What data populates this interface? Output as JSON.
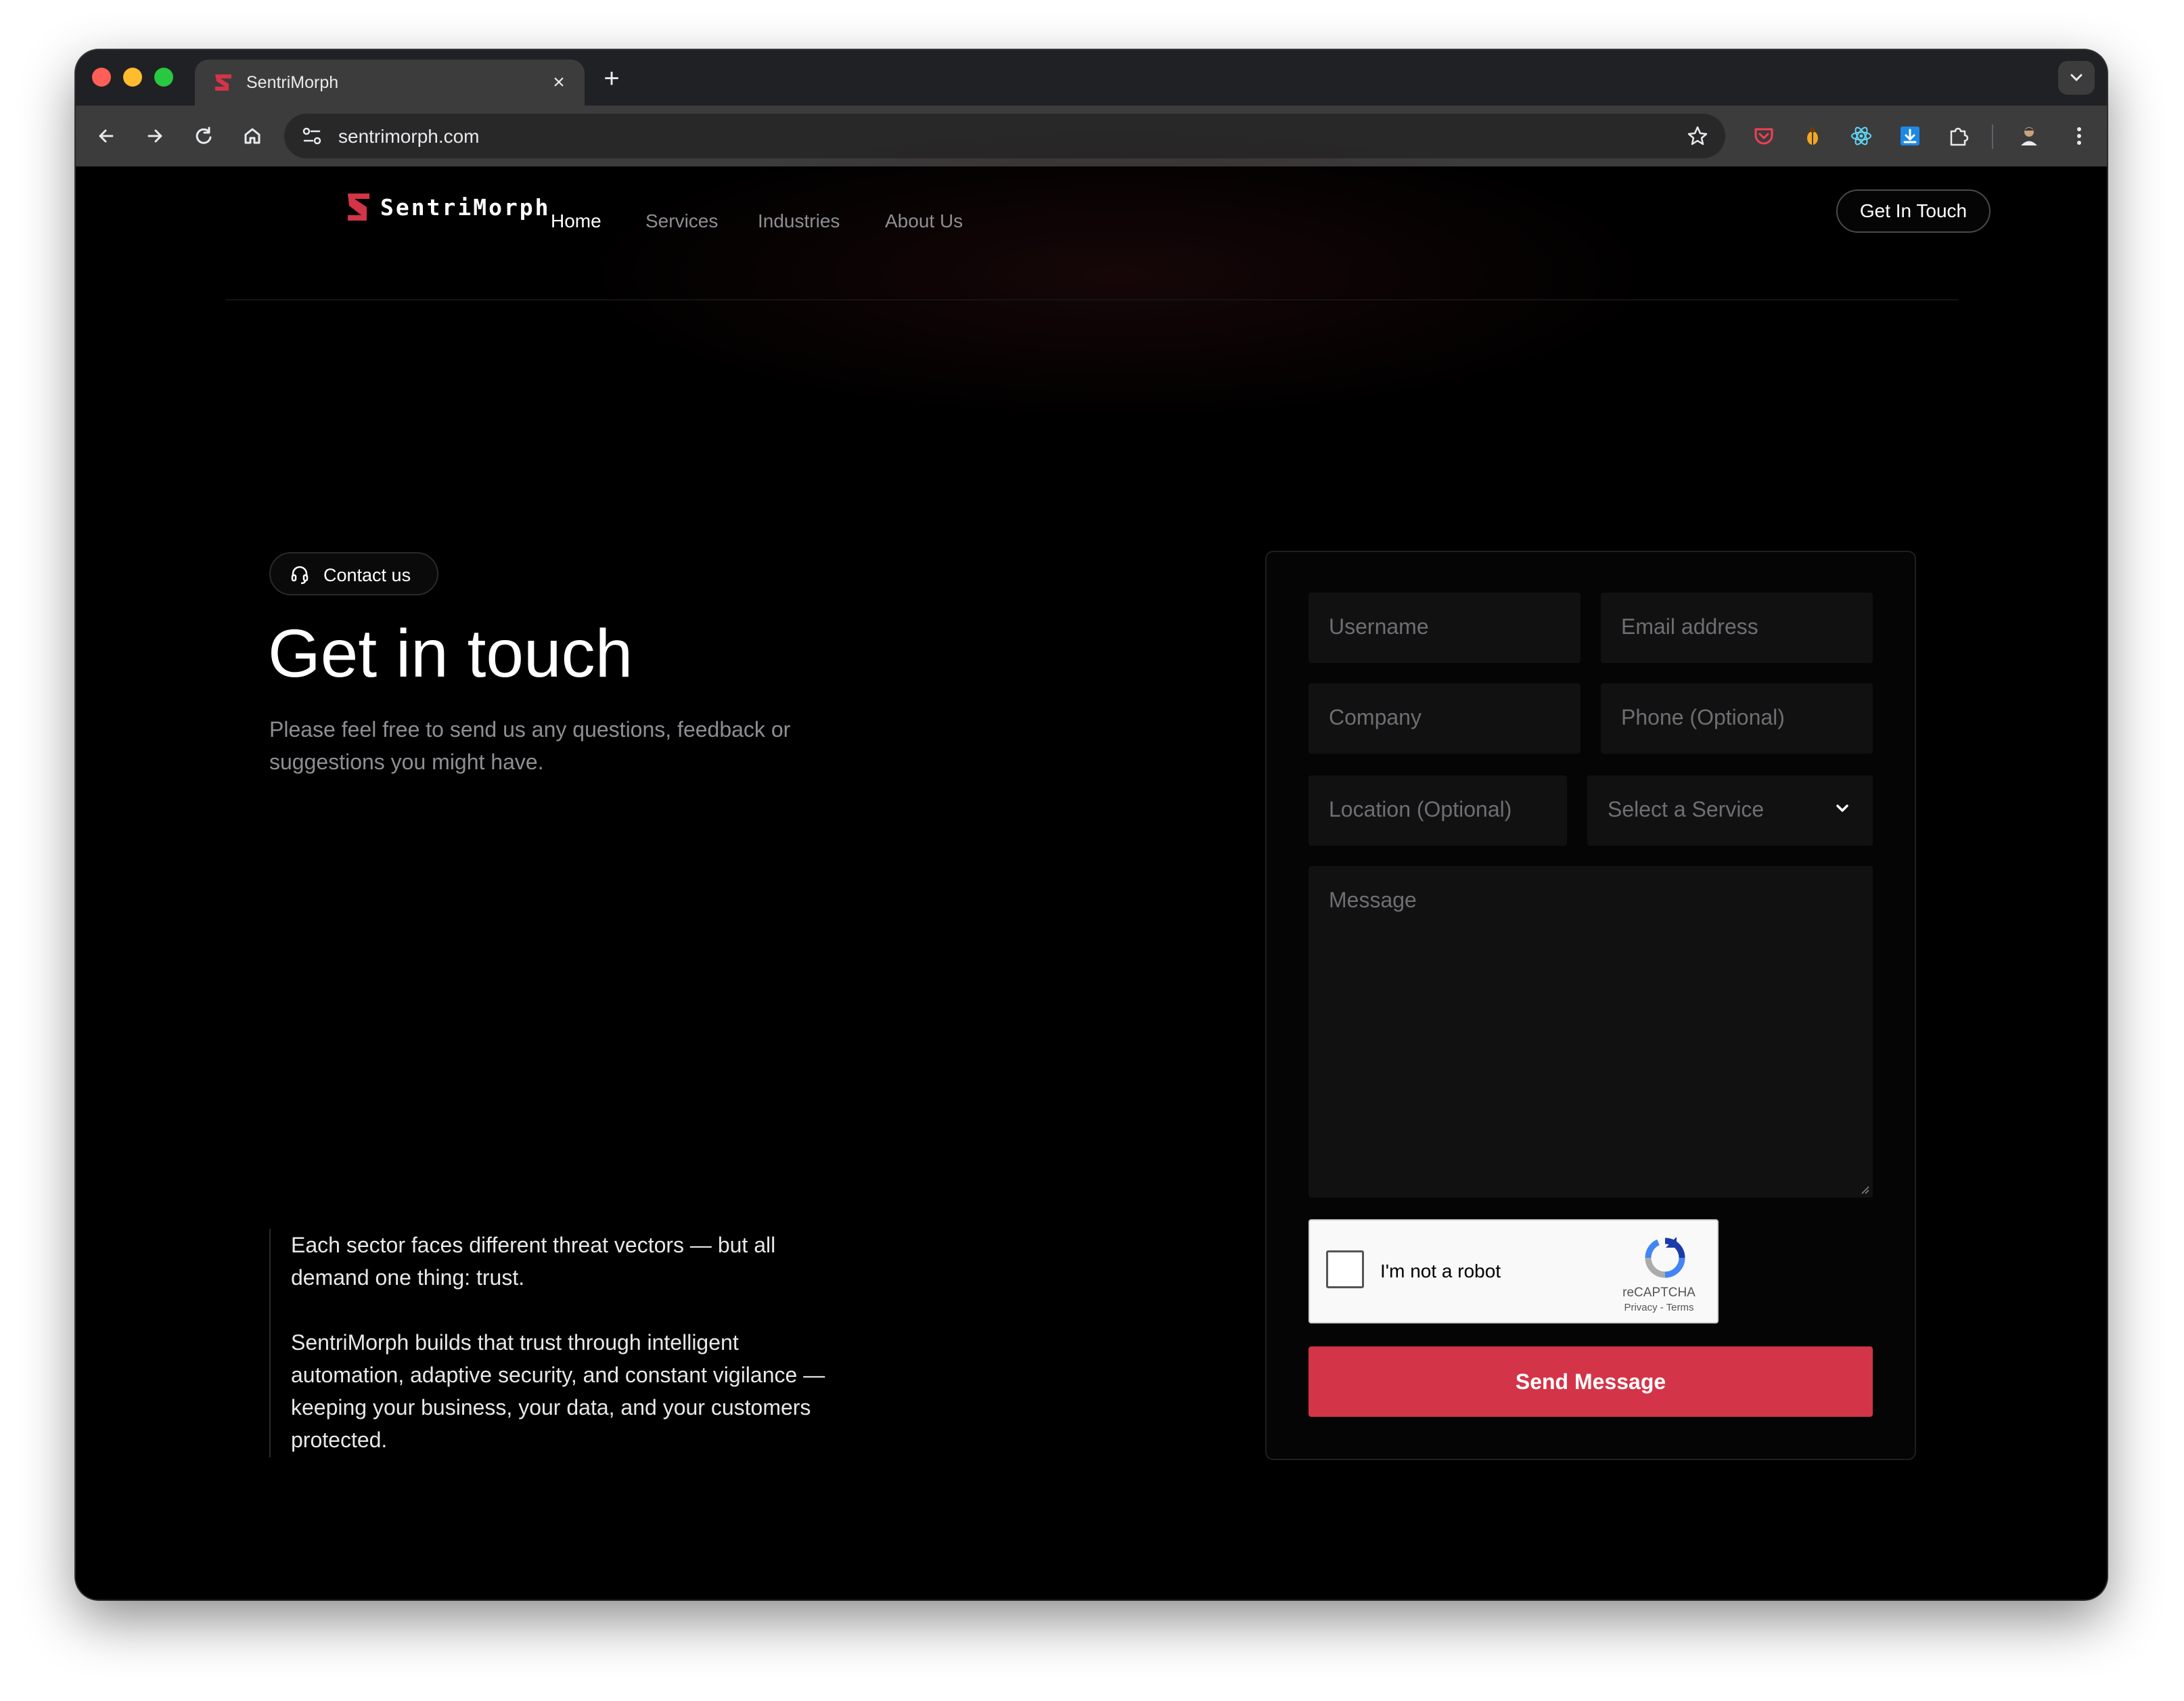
{
  "browser": {
    "tab_title": "SentriMorph",
    "url": "sentrimorph.com",
    "extensions": [
      "pocket-icon",
      "bug-icon",
      "react-icon",
      "download-icon",
      "puzzle-icon",
      "profile-icon"
    ]
  },
  "site": {
    "logo_text": "SentriMorph",
    "nav": {
      "home": "Home",
      "services": "Services",
      "industries": "Industries",
      "about": "About Us"
    },
    "cta": "Get In Touch"
  },
  "hero": {
    "pill": "Contact us",
    "heading": "Get in touch",
    "subtext": "Please feel free to send us any questions, feedback or suggestions you might have."
  },
  "quote": {
    "p1": "Each sector faces different threat vectors — but all demand one thing: trust.",
    "p2": "SentriMorph builds that trust through intelligent automation, adaptive security, and constant vigilance — keeping your business, your data, and your customers protected."
  },
  "form": {
    "username_placeholder": "Username",
    "email_placeholder": "Email address",
    "company_placeholder": "Company",
    "phone_placeholder": "Phone (Optional)",
    "location_placeholder": "Location (Optional)",
    "service_selected": "Select a Service",
    "message_placeholder": "Message",
    "captcha_label": "I'm not a robot",
    "captcha_brand": "reCAPTCHA",
    "captcha_links": "Privacy - Terms",
    "submit": "Send Message"
  },
  "colors": {
    "accent": "#d33448",
    "page_bg": "#000000",
    "field_bg": "#111111",
    "muted_text": "#8e8e93"
  }
}
